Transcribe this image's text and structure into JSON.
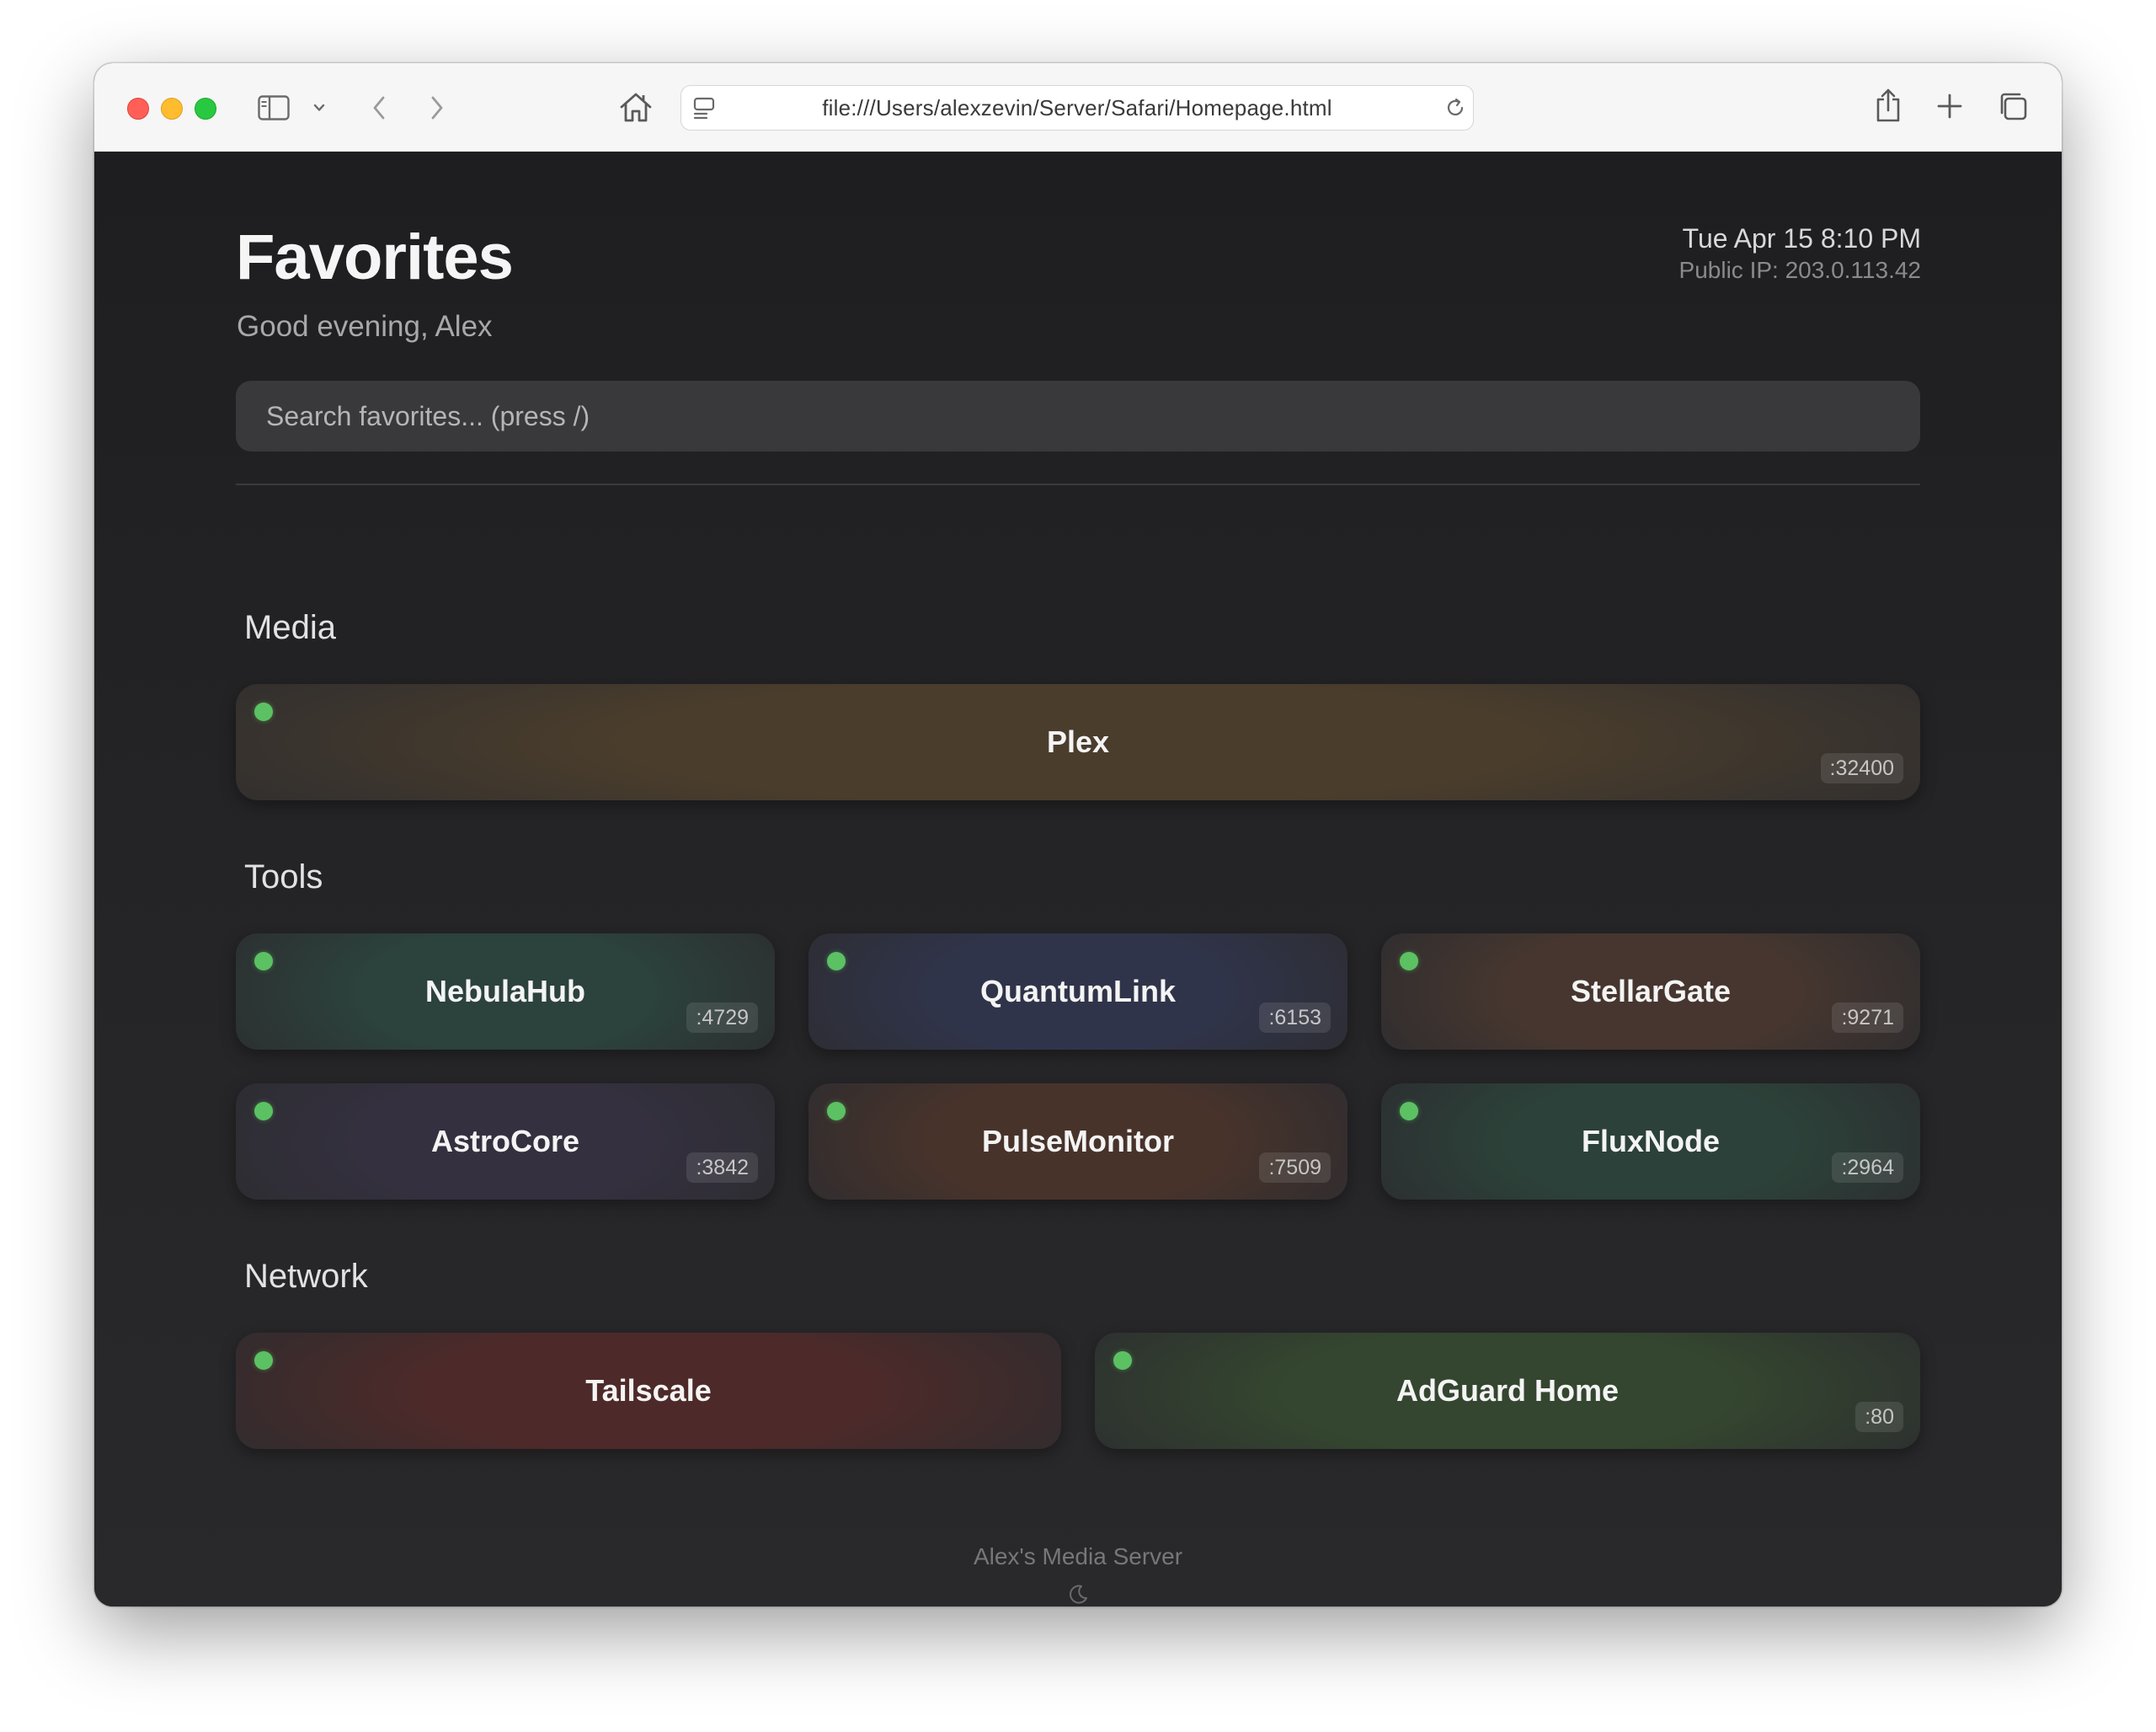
{
  "browser": {
    "url": "file:///Users/alexzevin/Server/Safari/Homepage.html",
    "icons": [
      "sidebar-icon",
      "chevron-down-icon",
      "back-arrow-icon",
      "forward-arrow-icon",
      "home-icon",
      "page-settings-icon",
      "reload-icon",
      "share-icon",
      "new-tab-icon",
      "tab-overview-icon"
    ]
  },
  "header": {
    "title": "Favorites",
    "greeting": "Good evening, Alex",
    "datetime": "Tue Apr 15 8:10 PM",
    "public_ip": "Public IP: 203.0.113.42"
  },
  "search": {
    "placeholder": "Search favorites... (press /)"
  },
  "sections": [
    {
      "title": "Media",
      "items": [
        {
          "name": "Plex",
          "port": ":32400",
          "status": "online",
          "color": "#4a3d2c"
        }
      ]
    },
    {
      "title": "Tools",
      "items": [
        {
          "name": "NebulaHub",
          "port": ":4729",
          "status": "online",
          "color": "#2c423c"
        },
        {
          "name": "QuantumLink",
          "port": ":6153",
          "status": "online",
          "color": "#30344a"
        },
        {
          "name": "StellarGate",
          "port": ":9271",
          "status": "online",
          "color": "#46362f"
        },
        {
          "name": "AstroCore",
          "port": ":3842",
          "status": "online",
          "color": "#34303f"
        },
        {
          "name": "PulseMonitor",
          "port": ":7509",
          "status": "online",
          "color": "#48332b"
        },
        {
          "name": "FluxNode",
          "port": ":2964",
          "status": "online",
          "color": "#2c4139"
        }
      ]
    },
    {
      "title": "Network",
      "items": [
        {
          "name": "Tailscale",
          "port": "",
          "status": "online",
          "color": "#4d2a29"
        },
        {
          "name": "AdGuard Home",
          "port": ":80",
          "status": "online",
          "color": "#34462f"
        }
      ]
    }
  ],
  "footer": {
    "text": "Alex's Media Server",
    "icon": "moon-icon"
  }
}
